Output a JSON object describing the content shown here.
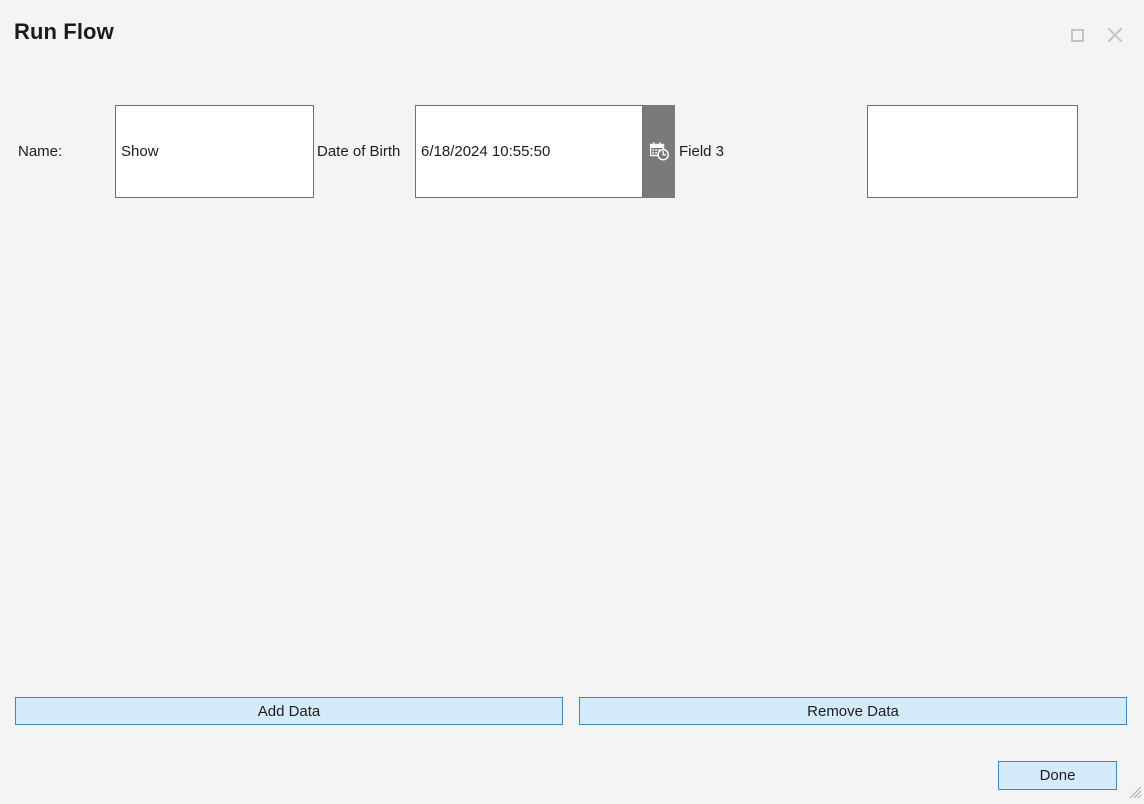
{
  "window": {
    "title": "Run Flow",
    "controls": [
      {
        "name": "maximize",
        "icon": "maximize-icon",
        "label": "Maximize"
      },
      {
        "name": "close",
        "icon": "close-icon",
        "label": "Close"
      }
    ],
    "colors": {
      "background": "#f4f4f4",
      "field_border": "#707070",
      "field_fill": "#ffffff",
      "button_fill": "#d4ebfb",
      "button_border": "#3c87c8",
      "picker_button_fill": "#7a7a7a",
      "control_glyph": "#c4c4c4",
      "text": "#1d1d1d"
    }
  },
  "form": {
    "fields": [
      {
        "label": "Name:",
        "value": "Show",
        "placeholder": "",
        "has_picker": false
      },
      {
        "label": "Date of Birth",
        "value": "6/18/2024 10:55:50",
        "placeholder": "",
        "has_picker": true,
        "picker_icon": "calendar-clock-icon"
      },
      {
        "label": "Field 3",
        "value": "",
        "placeholder": "",
        "has_picker": false
      }
    ]
  },
  "actions": {
    "add_data_label": "Add Data",
    "remove_data_label": "Remove Data",
    "done_label": "Done"
  },
  "resize": {
    "grip_icon": "resize-grip-icon"
  }
}
